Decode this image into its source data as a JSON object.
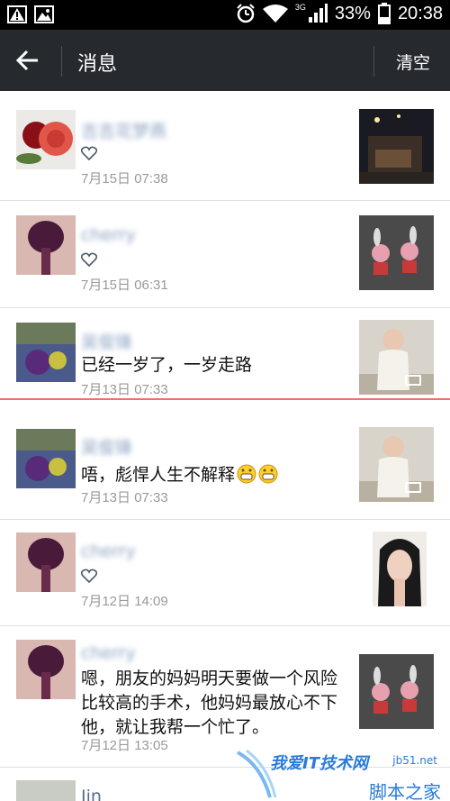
{
  "status_bar": {
    "network": "3G",
    "battery": "33%",
    "time": "20:38"
  },
  "action_bar": {
    "title": "消息",
    "clear_label": "清空"
  },
  "messages": [
    {
      "name": "吉吉花梦燕",
      "content": "",
      "liked": true,
      "time": "7月15日 07:38",
      "thumb": "night-room",
      "video": false
    },
    {
      "name": "cherry",
      "content": "",
      "liked": true,
      "time": "7月15日 06:31",
      "thumb": "rabbit-art",
      "video": false
    },
    {
      "name": "吴俊锋",
      "content": "已经一岁了，一岁走路",
      "liked": false,
      "time": "7月13日 07:33",
      "thumb": "baby",
      "video": true
    },
    {
      "name": "吴俊锋",
      "content": "唔，彪悍人生不解释",
      "liked": false,
      "time": "7月13日 07:33",
      "thumb": "baby",
      "video": true
    },
    {
      "name": "cherry",
      "content": "",
      "liked": true,
      "time": "7月12日 14:09",
      "thumb": "girl-portrait",
      "video": false
    },
    {
      "name": "cherry",
      "content": "嗯，朋友的妈妈明天要做一个风险比较高的手术，他妈妈最放心不下他，就让我帮一个忙了。",
      "liked": false,
      "time": "7月12日 13:05",
      "thumb": "rabbit-art",
      "video": false
    },
    {
      "name": "Jin",
      "content": "",
      "liked": false,
      "time": "",
      "thumb": "",
      "video": false
    }
  ],
  "watermark": {
    "line1": "我爱IT技术网",
    "url": "jb51.net",
    "line2": "脚本之家"
  },
  "colors": {
    "action_bar": "#262a2e",
    "status_bar": "#000000",
    "highlight_divider": "#e8736a",
    "name": "#8aa0c0",
    "time": "#999999"
  }
}
